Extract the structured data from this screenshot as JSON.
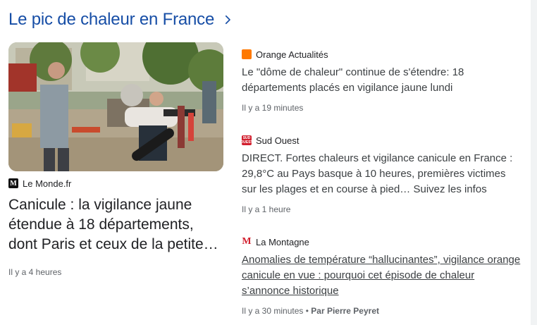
{
  "header": {
    "title": "Le pic de chaleur en France"
  },
  "lead": {
    "source": "Le Monde.fr",
    "logo_text": "M",
    "headline": "Canicule : la vigilance jaune étendue à 18 départements, dont Paris et ceux de la petite…",
    "time": "Il y a 4 heures"
  },
  "items": [
    {
      "source": "Orange Actualités",
      "headline": "Le \"dôme de chaleur\" continue de s'étendre: 18 départements placés en vigilance jaune lundi",
      "time": "Il y a 19 minutes"
    },
    {
      "source": "Sud Ouest",
      "logo_text": "SUD OUEST",
      "headline": "DIRECT. Fortes chaleurs et vigilance canicule en France : 29,8°C au Pays basque à 10 heures, premières victimes sur les plages et en course à pied… Suivez les infos",
      "time": "Il y a 1 heure"
    },
    {
      "source": "La Montagne",
      "logo_text": "M",
      "headline": "Anomalies de température “hallucinantes”, vigilance orange canicule en vue : pourquoi cet épisode de chaleur s’annonce historique",
      "time": "Il y a 30 minutes",
      "separator": "•",
      "author": "Par Pierre Peyret"
    }
  ],
  "colors": {
    "header": "#174ea6",
    "orange_logo": "#ff7900",
    "sudouest_logo": "#d2202f",
    "lamontagne_logo": "#d2202f"
  },
  "icons": {
    "header_chevron": "chevron-right-icon"
  }
}
